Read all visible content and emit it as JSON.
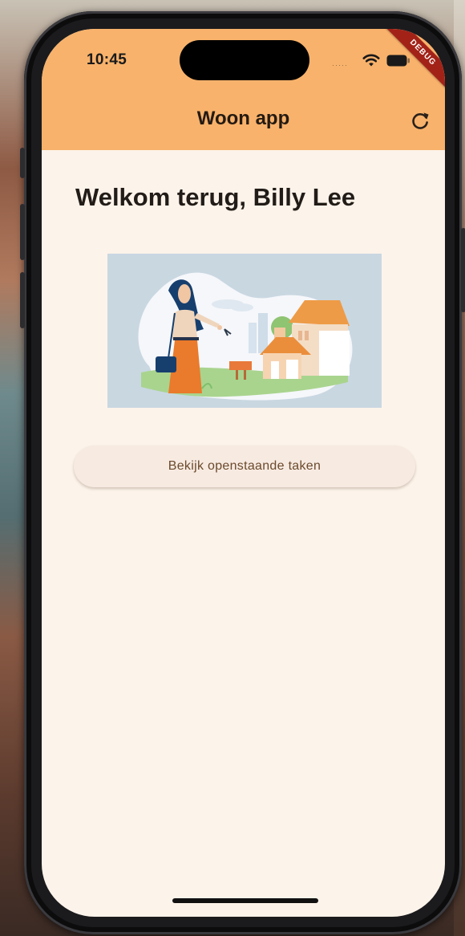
{
  "status_bar": {
    "time": "10:45",
    "signal": "·····"
  },
  "debug_banner": "DEBUG",
  "app_bar": {
    "title": "Woon app",
    "refresh_icon": "refresh-icon"
  },
  "main": {
    "welcome_text": "Welkom terug, Billy Lee",
    "illustration": "woman-with-keys-and-house-illustration",
    "tasks_button_label": "Bekijk openstaande taken"
  },
  "colors": {
    "app_bar": "#f8b26b",
    "background": "#fcf3ea",
    "button_bg": "#f7eae1",
    "button_text": "#6b4a2c",
    "debug_ribbon": "#a32218"
  }
}
